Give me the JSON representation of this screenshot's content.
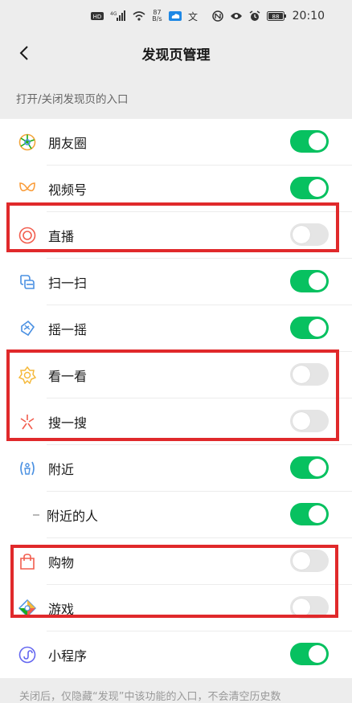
{
  "status": {
    "net_speed": "87",
    "net_unit": "B/s",
    "battery": "88",
    "time": "20:10",
    "hd": "HD",
    "signal": "⁴ᴳ"
  },
  "header": {
    "title": "发现页管理"
  },
  "section_label": "打开/关闭发现页的入口",
  "items": [
    {
      "label": "朋友圈",
      "icon": "moments-icon",
      "on": true
    },
    {
      "label": "视频号",
      "icon": "channels-icon",
      "on": true
    },
    {
      "label": "直播",
      "icon": "live-icon",
      "on": false
    },
    {
      "label": "扫一扫",
      "icon": "scan-icon",
      "on": true
    },
    {
      "label": "摇一摇",
      "icon": "shake-icon",
      "on": true
    },
    {
      "label": "看一看",
      "icon": "top-stories-icon",
      "on": false
    },
    {
      "label": "搜一搜",
      "icon": "search-icon",
      "on": false
    },
    {
      "label": "附近",
      "icon": "nearby-icon",
      "on": true
    },
    {
      "label": "附近的人",
      "icon": "dash-icon",
      "on": true,
      "sub": true
    },
    {
      "label": "购物",
      "icon": "shopping-bag-icon",
      "on": false
    },
    {
      "label": "游戏",
      "icon": "game-icon",
      "on": false
    },
    {
      "label": "小程序",
      "icon": "mini-program-icon",
      "on": true
    }
  ],
  "footer": "关闭后，仅隐藏“发现”中该功能的入口，不会清空历史数",
  "colors": {
    "accent": "#07c160",
    "highlight": "#e0292b",
    "toggle_off": "#e5e5e5"
  }
}
